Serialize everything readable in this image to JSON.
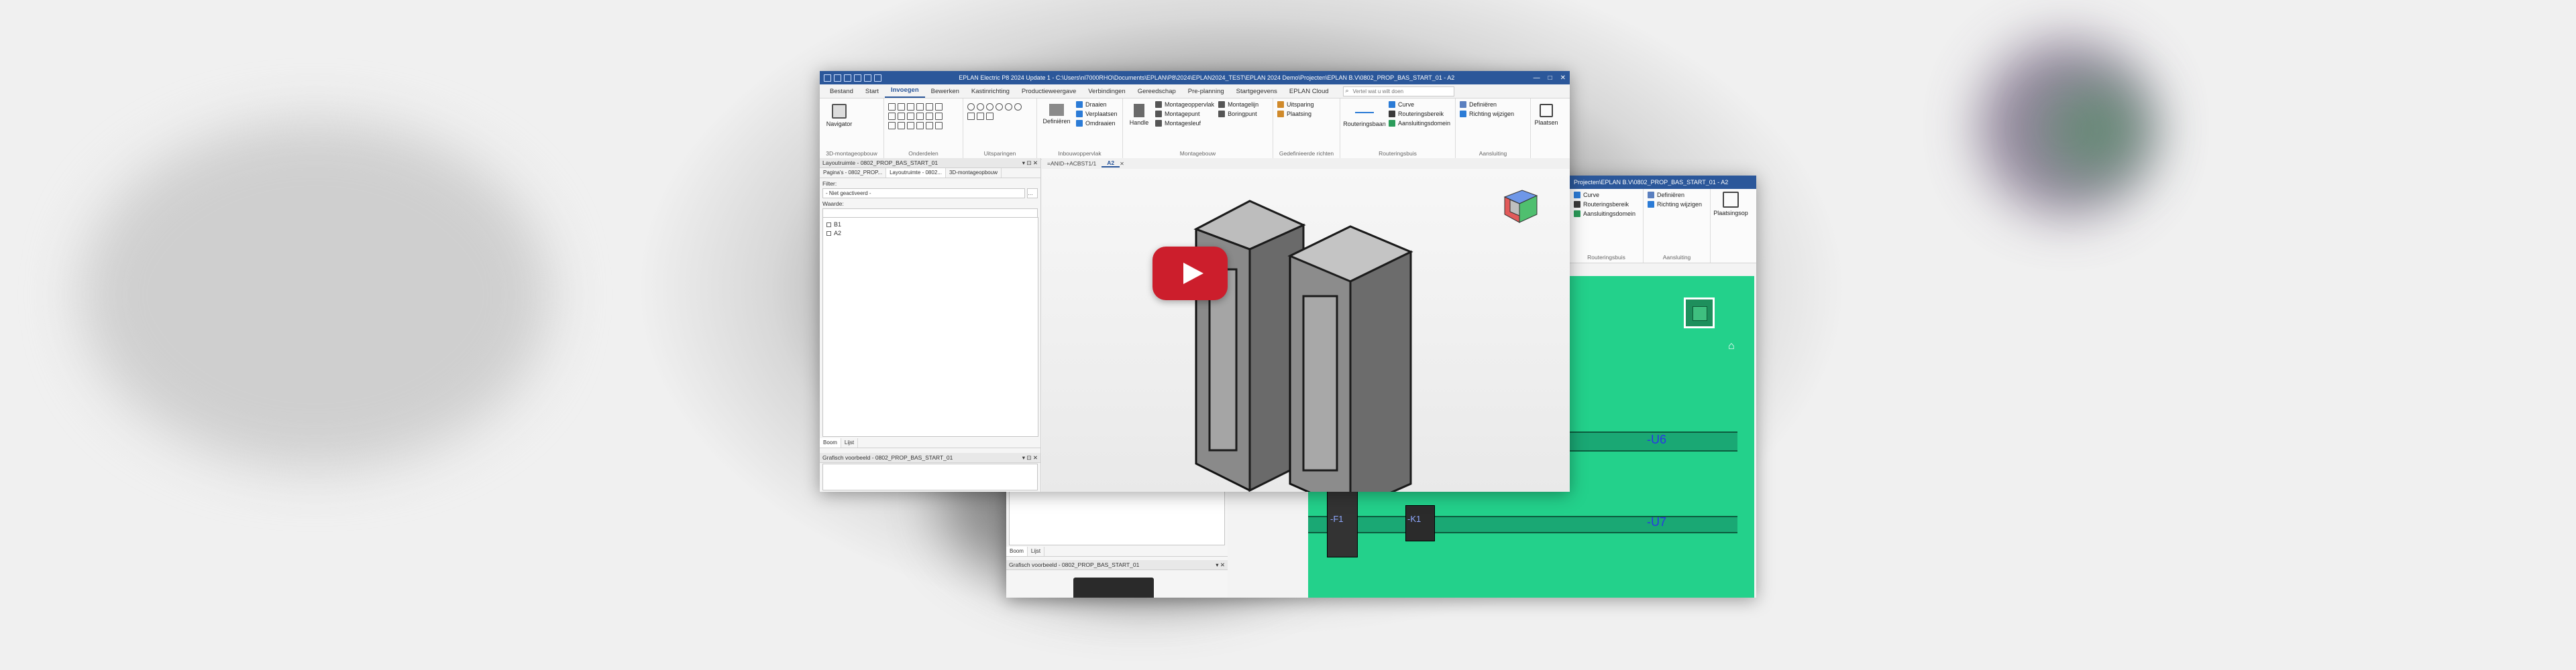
{
  "main_window": {
    "title": "EPLAN Electric P8 2024 Update 1 - C:\\Users\\nl7000RHO\\Documents\\EPLAN\\P8\\2024\\EPLAN2024_TEST\\EPLAN 2024 Demo\\Projecten\\EPLAN B.V\\0802_PROP_BAS_START_01 - A2",
    "window_controls": [
      "—",
      "□",
      "✕"
    ],
    "menu_tabs": [
      "Bestand",
      "Start",
      "Invoegen",
      "Bewerken",
      "Kastinrichting",
      "Productieweergave",
      "Verbindingen",
      "Gereedschap",
      "Pre-planning",
      "Startgegevens",
      "EPLAN Cloud"
    ],
    "active_tab": "Invoegen",
    "search_placeholder": "Vertel wat u wilt doen",
    "ribbon_groups": [
      {
        "name": "3D-montageopbouw",
        "big_button": "Navigator"
      },
      {
        "name": "Onderdelen"
      },
      {
        "name": "Uitsparingen"
      },
      {
        "name": "Inbouwoppervlak",
        "big_button": "Definiëren",
        "small": [
          "Draaien",
          "Verplaatsen",
          "Omdraaien"
        ]
      },
      {
        "name": "Montagebouw",
        "big_button": "Handle",
        "small": [
          "Montageoppervlak",
          "Montagepunt",
          "Montagesleuf",
          "Montagelijn",
          "Boringpunt"
        ]
      },
      {
        "name": "Gedefinieerde richten",
        "small": [
          "Uitsparing",
          "Plaatsing"
        ]
      },
      {
        "name": "Routeringsbuis",
        "big_button": "Routeringsbaan",
        "small": [
          "Curve",
          "Routeringsbereik",
          "Aansluitingsdomein"
        ]
      },
      {
        "name": "Aansluiting",
        "small": [
          "Definiëren",
          "Richting wijzigen"
        ]
      },
      {
        "name": "",
        "big_button": "Plaatsen"
      }
    ],
    "left_panel": {
      "header": "Layoutruimte - 0802_PROP_BAS_START_01",
      "tabs": [
        "Pagina's - 0802_PROP...",
        "Layoutruimte - 0802...",
        "3D-montageopbouw"
      ],
      "filter_label": "Filter:",
      "filter_value": "- Niet geactiveerd -",
      "value_label": "Waarde:",
      "tree": [
        "B1",
        "A2"
      ],
      "bottom_tabs": [
        "Boom",
        "Lijst"
      ],
      "preview_header": "Grafisch voorbeeld - 0802_PROP_BAS_START_01"
    },
    "doc_tabs": [
      "=ANID-+ACBST1/1",
      "A2"
    ],
    "active_doc_tab": "A2"
  },
  "back_window": {
    "title": "Projecten\\EPLAN B.V\\0802_PROP_BAS_START_01 - A2",
    "ribbon_small": [
      "Curve",
      "Routeringsbereik",
      "Aansluitingsdomein",
      "Definiëren",
      "Richting wijzigen"
    ],
    "plaatsen_label": "Plaatsingsop",
    "group_names": [
      "Routeringsbuis",
      "Aansluiting"
    ],
    "labels": [
      "-U6",
      "-U7",
      "-K1",
      "-F1"
    ],
    "bottom_tabs": [
      "Boom",
      "Lijst"
    ],
    "preview_header": "Grafisch voorbeeld - 0802_PROP_BAS_START_01"
  },
  "colors": {
    "title_blue": "#2b579a",
    "canvas_green": "#23d18b",
    "play_red": "#cc1e2c",
    "label_blue": "#2b36e6"
  },
  "icons": [
    "youtube-play-icon",
    "view-cube-icon",
    "home-icon"
  ]
}
